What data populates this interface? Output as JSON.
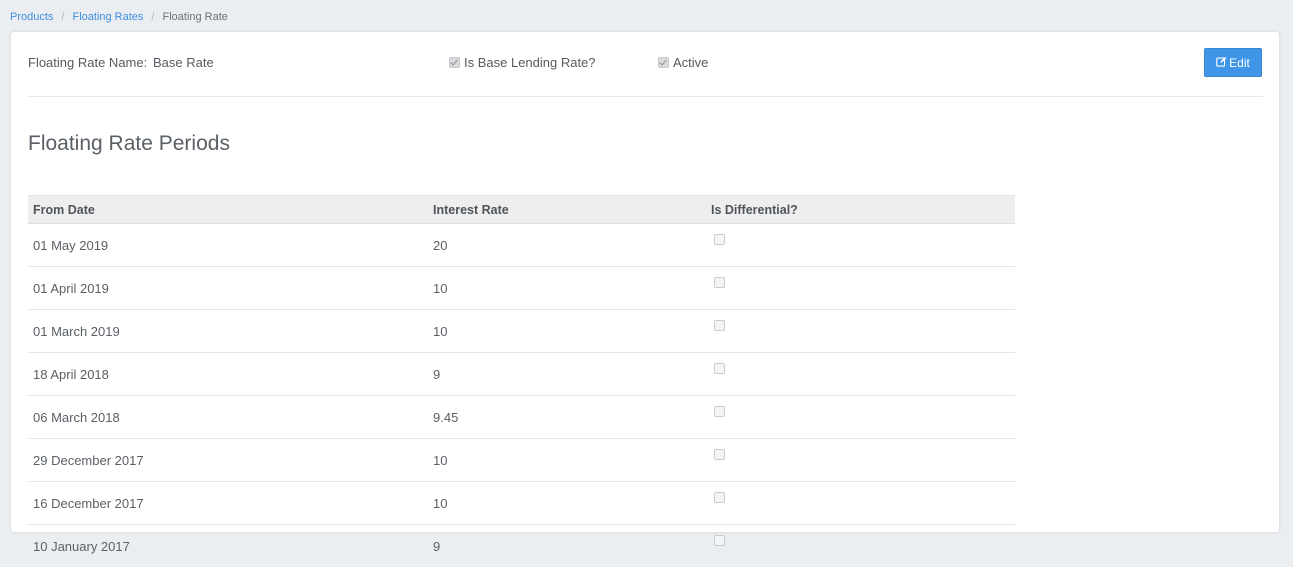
{
  "breadcrumb": {
    "items": [
      {
        "label": "Products"
      },
      {
        "label": "Floating Rates"
      }
    ],
    "separator": "/",
    "current": "Floating Rate"
  },
  "detail": {
    "name_label": "Floating Rate Name:",
    "name_value": "Base Rate",
    "is_base_lending_rate_label": "Is Base Lending Rate?",
    "is_base_lending_rate": true,
    "active_label": "Active",
    "active": true,
    "edit_label": "Edit",
    "edit_icon": "pencil-square-icon"
  },
  "periods": {
    "title": "Floating Rate Periods",
    "columns": [
      "From Date",
      "Interest Rate",
      "Is Differential?"
    ],
    "rows": [
      {
        "from_date": "01 May 2019",
        "interest_rate": "20",
        "is_differential": false
      },
      {
        "from_date": "01 April 2019",
        "interest_rate": "10",
        "is_differential": false
      },
      {
        "from_date": "01 March 2019",
        "interest_rate": "10",
        "is_differential": false
      },
      {
        "from_date": "18 April 2018",
        "interest_rate": "9",
        "is_differential": false
      },
      {
        "from_date": "06 March 2018",
        "interest_rate": "9.45",
        "is_differential": false
      },
      {
        "from_date": "29 December 2017",
        "interest_rate": "10",
        "is_differential": false
      },
      {
        "from_date": "16 December 2017",
        "interest_rate": "10",
        "is_differential": false
      },
      {
        "from_date": "10 January 2017",
        "interest_rate": "9",
        "is_differential": false
      }
    ]
  },
  "colors": {
    "accent": "#3f95e8",
    "link": "#3d8de0",
    "background": "#ebeef1"
  }
}
